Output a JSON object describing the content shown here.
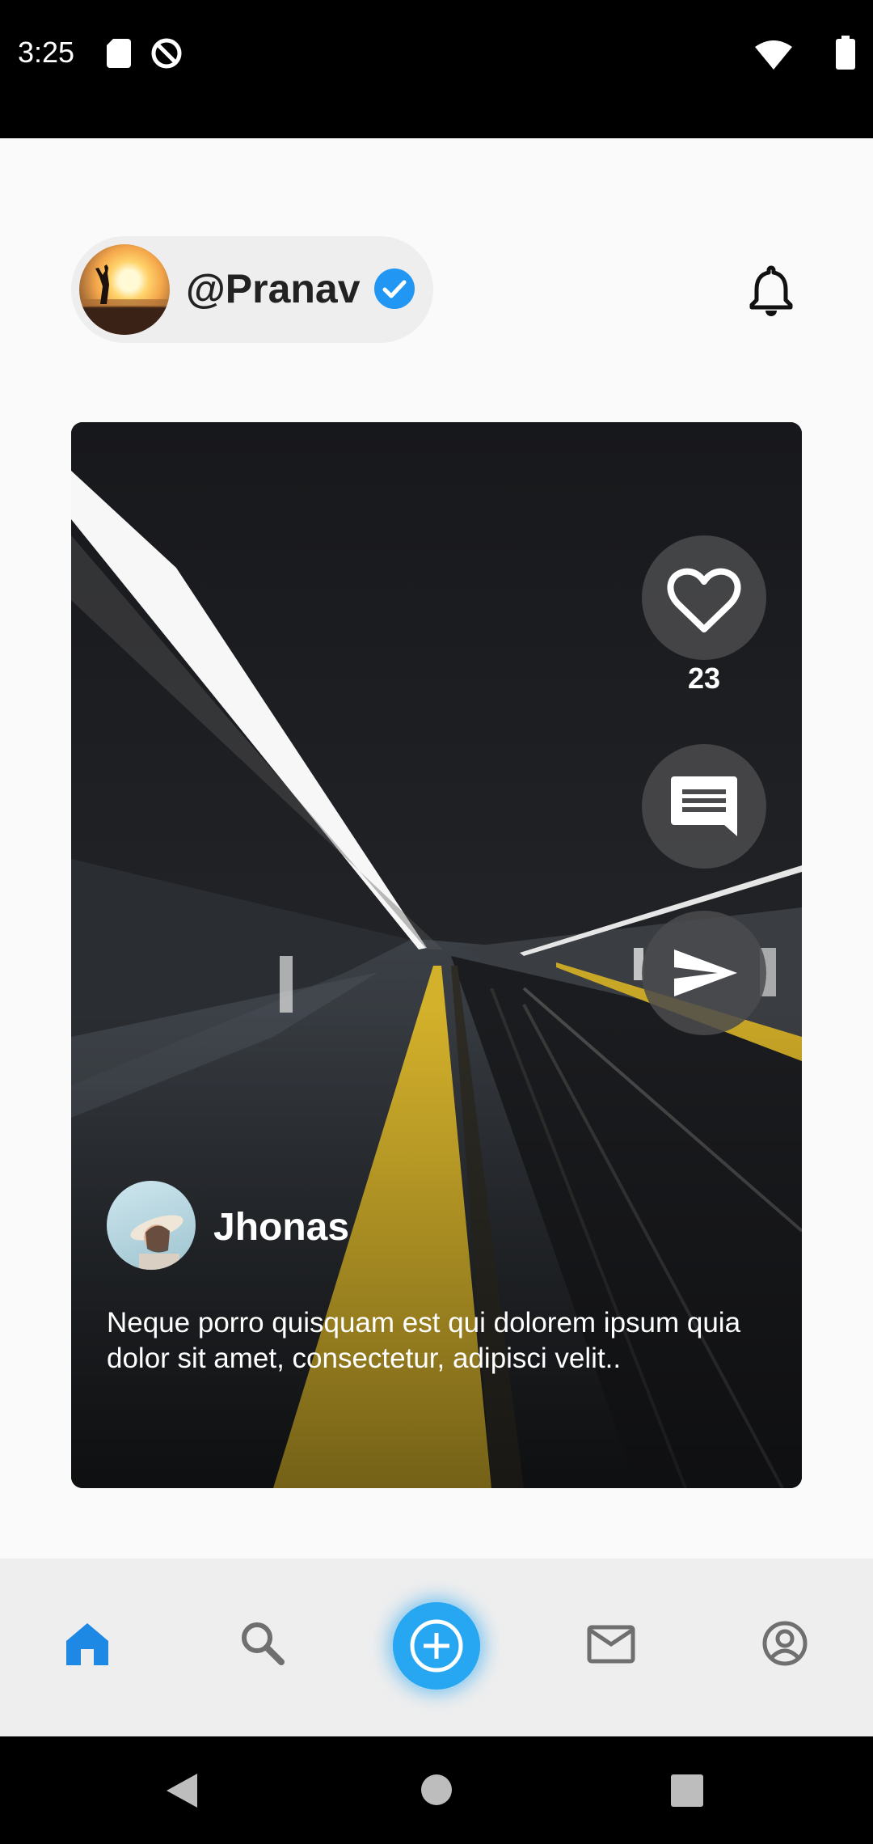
{
  "status_bar": {
    "time": "3:25",
    "icons": [
      "sd-card-icon",
      "do-not-disturb-icon",
      "wifi-icon",
      "battery-icon"
    ]
  },
  "header": {
    "username": "@Pranav",
    "verified": true,
    "avatar": "sunset-silhouette-avatar",
    "notification_icon": "bell-icon"
  },
  "post": {
    "likes": "23",
    "actions": [
      "heart-icon",
      "comment-icon",
      "send-icon"
    ],
    "author": "Jhonas",
    "caption": "Neque porro quisquam est qui dolorem ipsum quia dolor sit amet, consectetur, adipisci velit.."
  },
  "bottom_nav": {
    "items": [
      {
        "icon": "home-icon",
        "active": true
      },
      {
        "icon": "search-icon",
        "active": false
      },
      {
        "icon": "add-icon",
        "active": false
      },
      {
        "icon": "mail-icon",
        "active": false
      },
      {
        "icon": "account-icon",
        "active": false
      }
    ],
    "active_color": "#1e88e5",
    "inactive_color": "#6f6f6f",
    "fab_color": "#27a6f2"
  },
  "colors": {
    "verified": "#2196f3",
    "platform_stripe": "#d4b12b"
  }
}
